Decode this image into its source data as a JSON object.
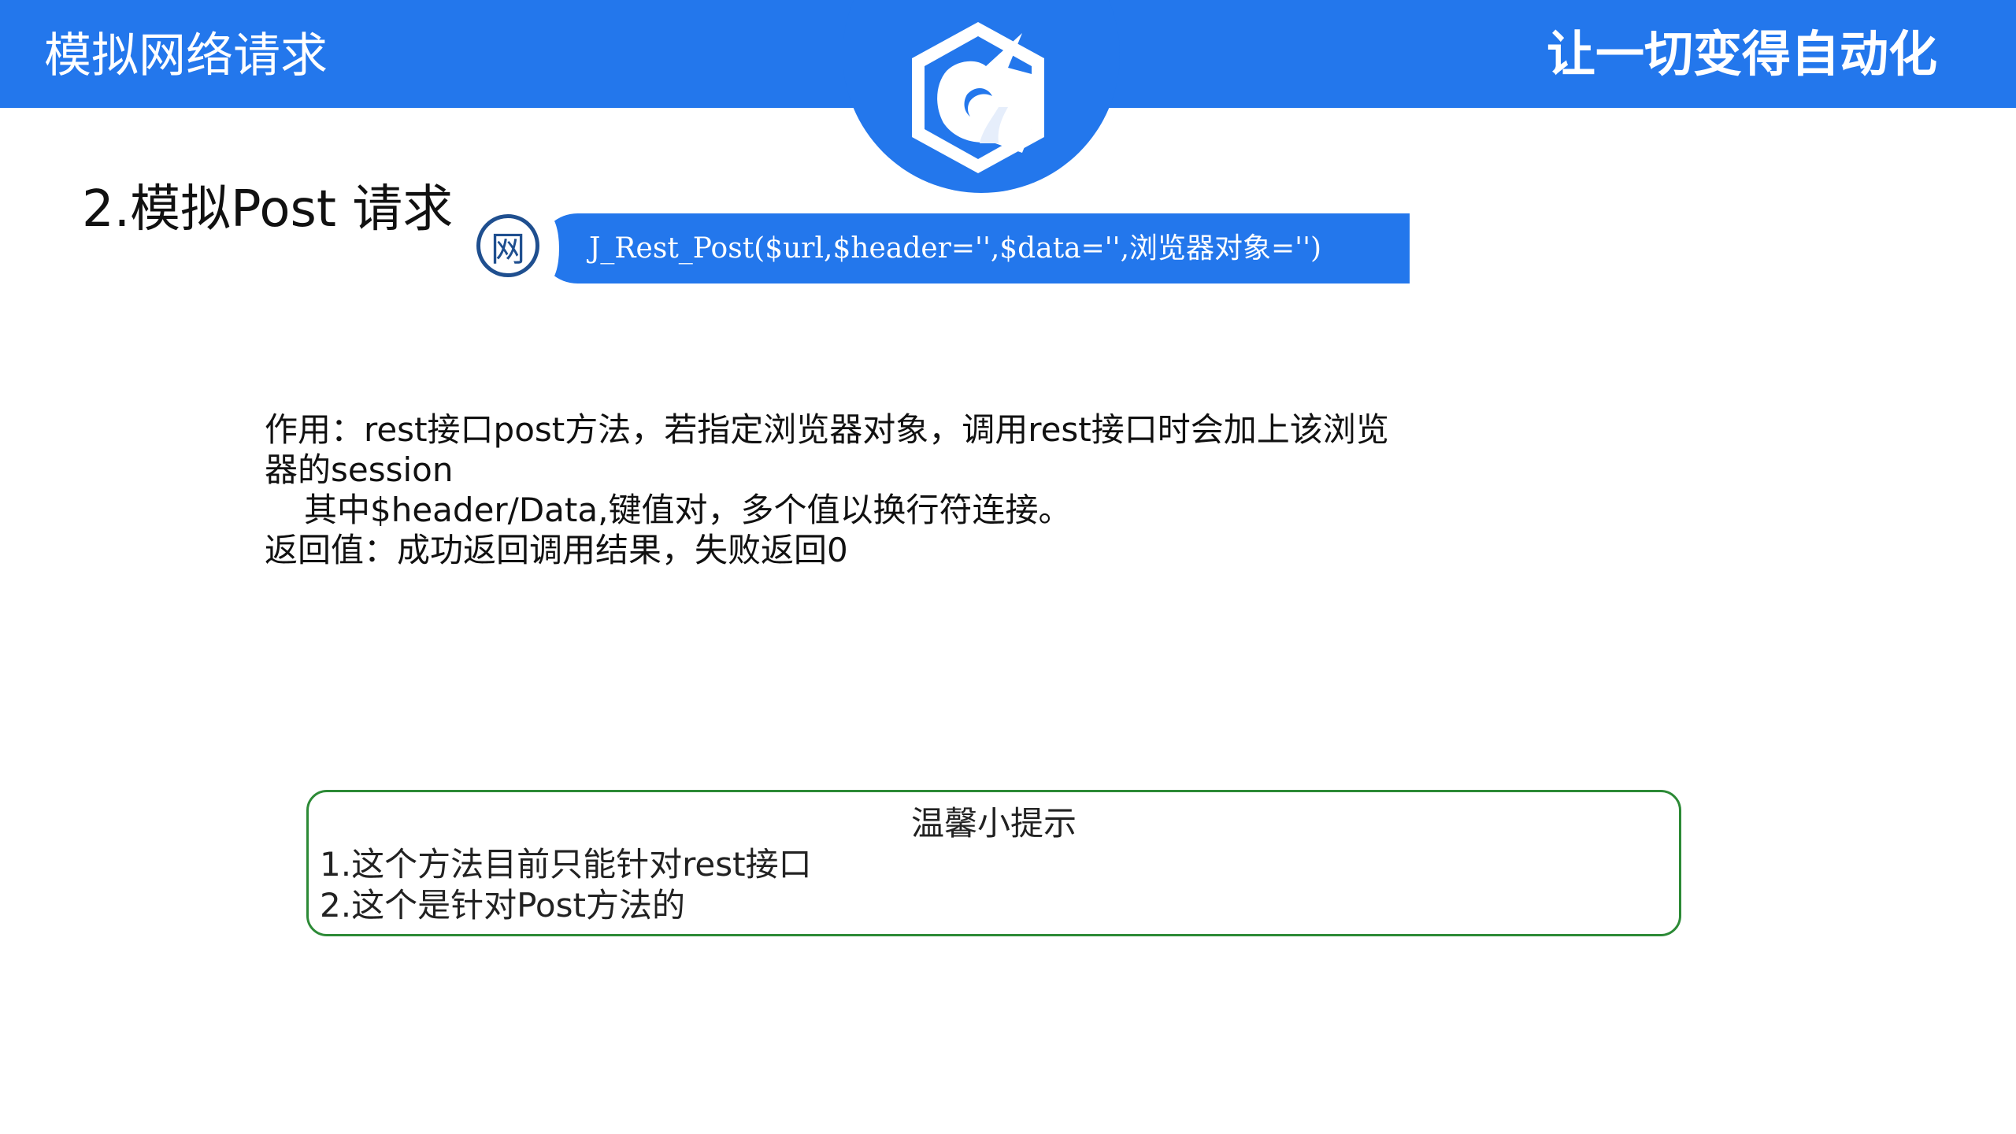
{
  "header": {
    "title": "模拟网络请求",
    "slogan": "让一切变得自动化"
  },
  "section": {
    "title": "2.模拟Post 请求"
  },
  "function": {
    "badge": "网",
    "signature": "J_Rest_Post($url,$header='',$data='',浏览器对象='')"
  },
  "description": {
    "lines": [
      "作用：rest接口post方法，若指定浏览器对象，调用rest接口时会加上该浏览",
      "器的session",
      "其中$header/Data,键值对，多个值以换行符连接。",
      "返回值：成功返回调用结果，失败返回0"
    ]
  },
  "tip": {
    "title": "温馨小提示",
    "items": [
      "1.这个方法目前只能针对rest接口",
      "2.这个是针对Post方法的"
    ]
  },
  "colors": {
    "brand_blue": "#2377ec",
    "badge_ring": "#1f4f8f",
    "tip_border": "#2c8a36"
  },
  "icons": {
    "logo": "unicorn-hexagon-logo"
  }
}
